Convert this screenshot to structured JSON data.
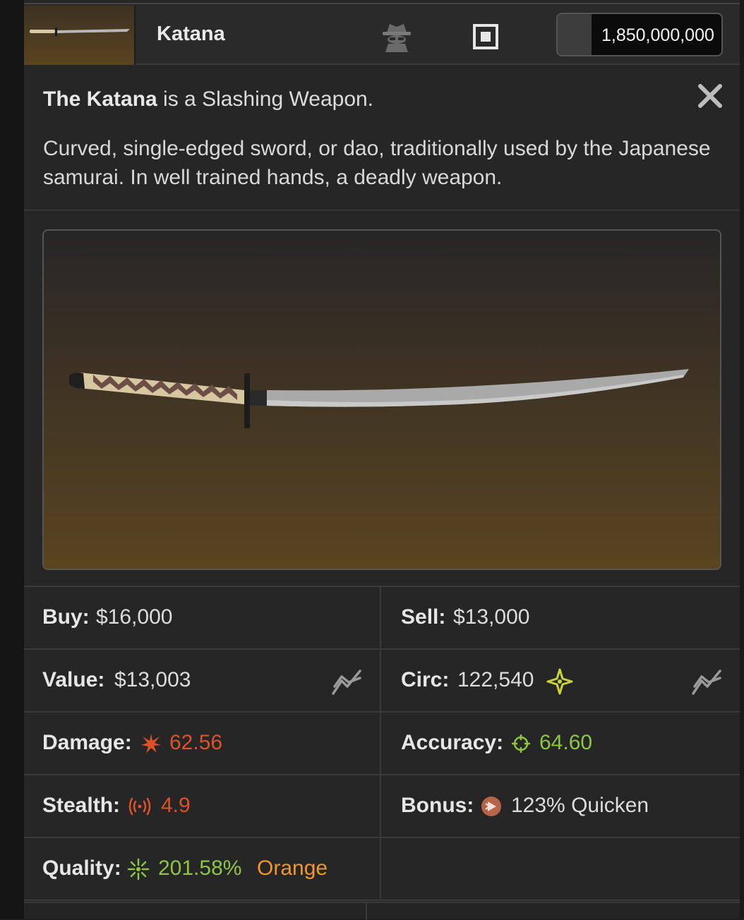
{
  "header": {
    "item_name": "Katana",
    "money": "1,850,000,000",
    "icons": [
      "spy-icon",
      "equip-square-icon"
    ]
  },
  "description": {
    "name": "The Katana",
    "type_text": " is a Slashing Weapon.",
    "text": "Curved, single-edged sword, or dao, traditionally used by the Japanese samurai. In well trained hands, a deadly weapon."
  },
  "stats": {
    "buy_label": "Buy:",
    "buy_value": "$16,000",
    "sell_label": "Sell:",
    "sell_value": "$13,000",
    "value_label": "Value:",
    "value_value": "$13,003",
    "circ_label": "Circ:",
    "circ_value": "122,540",
    "damage_label": "Damage:",
    "damage_value": "62.56",
    "accuracy_label": "Accuracy:",
    "accuracy_value": "64.60",
    "stealth_label": "Stealth:",
    "stealth_value": "4.9",
    "bonus_label": "Bonus:",
    "bonus_value": "123% Quicken",
    "quality_label": "Quality:",
    "quality_value": "201.58%",
    "quality_tier": "Orange"
  },
  "colors": {
    "damage": "#e0502a",
    "accuracy": "#8dc63f",
    "stealth": "#e0502a",
    "quality": "#8dc63f",
    "quality_tier": "#f0962a",
    "circ_star": "#c8d43a"
  }
}
